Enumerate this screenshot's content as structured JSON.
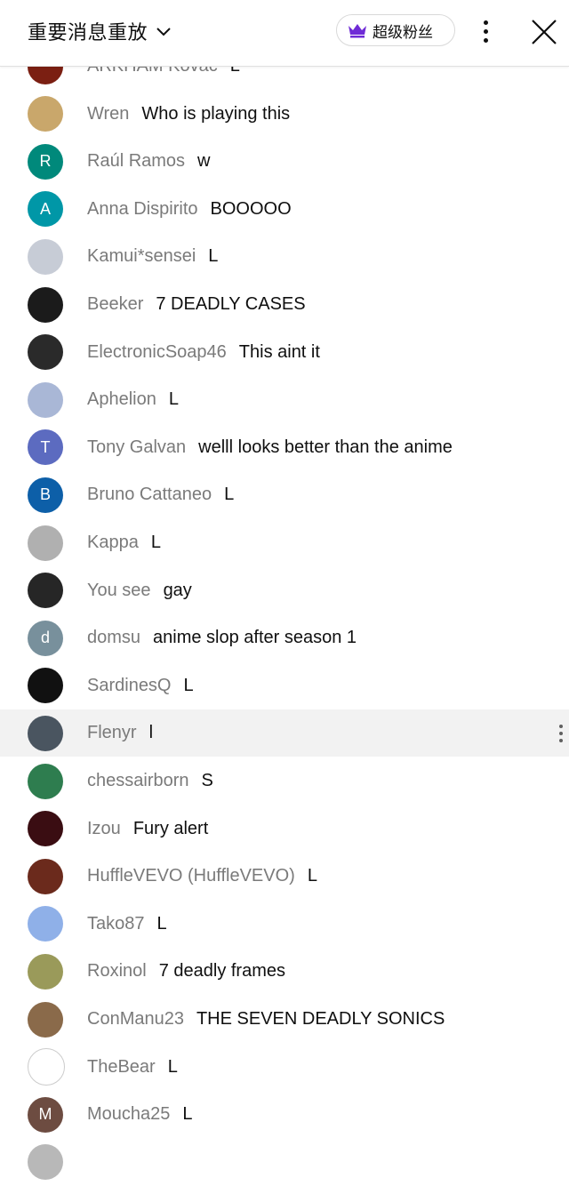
{
  "header": {
    "title": "重要消息重放",
    "sponsor_label": "超级粉丝",
    "accent_color": "#6f2bd6"
  },
  "messages": [
    {
      "author": "ARKHAM Kovac",
      "text": "L",
      "avatar_color": "#7b1f12",
      "initial": ""
    },
    {
      "author": "Wren",
      "text": "Who is playing this",
      "avatar_color": "#c9a76b",
      "initial": ""
    },
    {
      "author": "Raúl Ramos",
      "text": "w",
      "avatar_color": "#00897b",
      "initial": "R"
    },
    {
      "author": "Anna Dispirito",
      "text": "BOOOOO",
      "avatar_color": "#0097a7",
      "initial": "A"
    },
    {
      "author": "Kamui*sensei",
      "text": "L",
      "avatar_color": "#c7ccd6",
      "initial": ""
    },
    {
      "author": "Beeker",
      "text": "7 DEADLY CASES",
      "avatar_color": "#1b1b1b",
      "initial": ""
    },
    {
      "author": "ElectronicSoap46",
      "text": "This aint it",
      "avatar_color": "#2a2a2a",
      "initial": ""
    },
    {
      "author": "Aphelion",
      "text": "L",
      "avatar_color": "#a9b7d6",
      "initial": ""
    },
    {
      "author": "Tony Galvan",
      "text": "welll looks better than the anime",
      "avatar_color": "#5c6bc0",
      "initial": "T"
    },
    {
      "author": "Bruno Cattaneo",
      "text": "L",
      "avatar_color": "#0d5fa8",
      "initial": "B"
    },
    {
      "author": "Kappa",
      "text": "L",
      "avatar_color": "#b0b0b0",
      "initial": ""
    },
    {
      "author": "You see",
      "text": "gay",
      "avatar_color": "#262626",
      "initial": ""
    },
    {
      "author": "domsu",
      "text": "anime slop after season 1",
      "avatar_color": "#78909c",
      "initial": "d"
    },
    {
      "author": "SardinesQ",
      "text": "L",
      "avatar_color": "#111111",
      "initial": ""
    },
    {
      "author": "Flenyr",
      "text": "l",
      "avatar_color": "#4a5560",
      "initial": ""
    },
    {
      "author": "chessairborn",
      "text": "S",
      "avatar_color": "#2e7d4f",
      "initial": ""
    },
    {
      "author": "Izou",
      "text": "Fury alert",
      "avatar_color": "#3a0d12",
      "initial": ""
    },
    {
      "author": "HuffleVEVO (HuffleVEVO)",
      "text": "L",
      "avatar_color": "#6b2a1c",
      "initial": ""
    },
    {
      "author": "Tako87",
      "text": "L",
      "avatar_color": "#8fb0e8",
      "initial": ""
    },
    {
      "author": "Roxinol",
      "text": "7 deadly frames",
      "avatar_color": "#9a9a5a",
      "initial": ""
    },
    {
      "author": "ConManu23",
      "text": "THE SEVEN DEADLY SONICS",
      "avatar_color": "#8a6a4a",
      "initial": ""
    },
    {
      "author": "TheBear",
      "text": "L",
      "avatar_color": "#ffffff",
      "initial": ""
    },
    {
      "author": "Moucha25",
      "text": "L",
      "avatar_color": "#6d4c41",
      "initial": "M"
    },
    {
      "author": "",
      "text": "",
      "avatar_color": "#b8b8b8",
      "initial": ""
    }
  ]
}
